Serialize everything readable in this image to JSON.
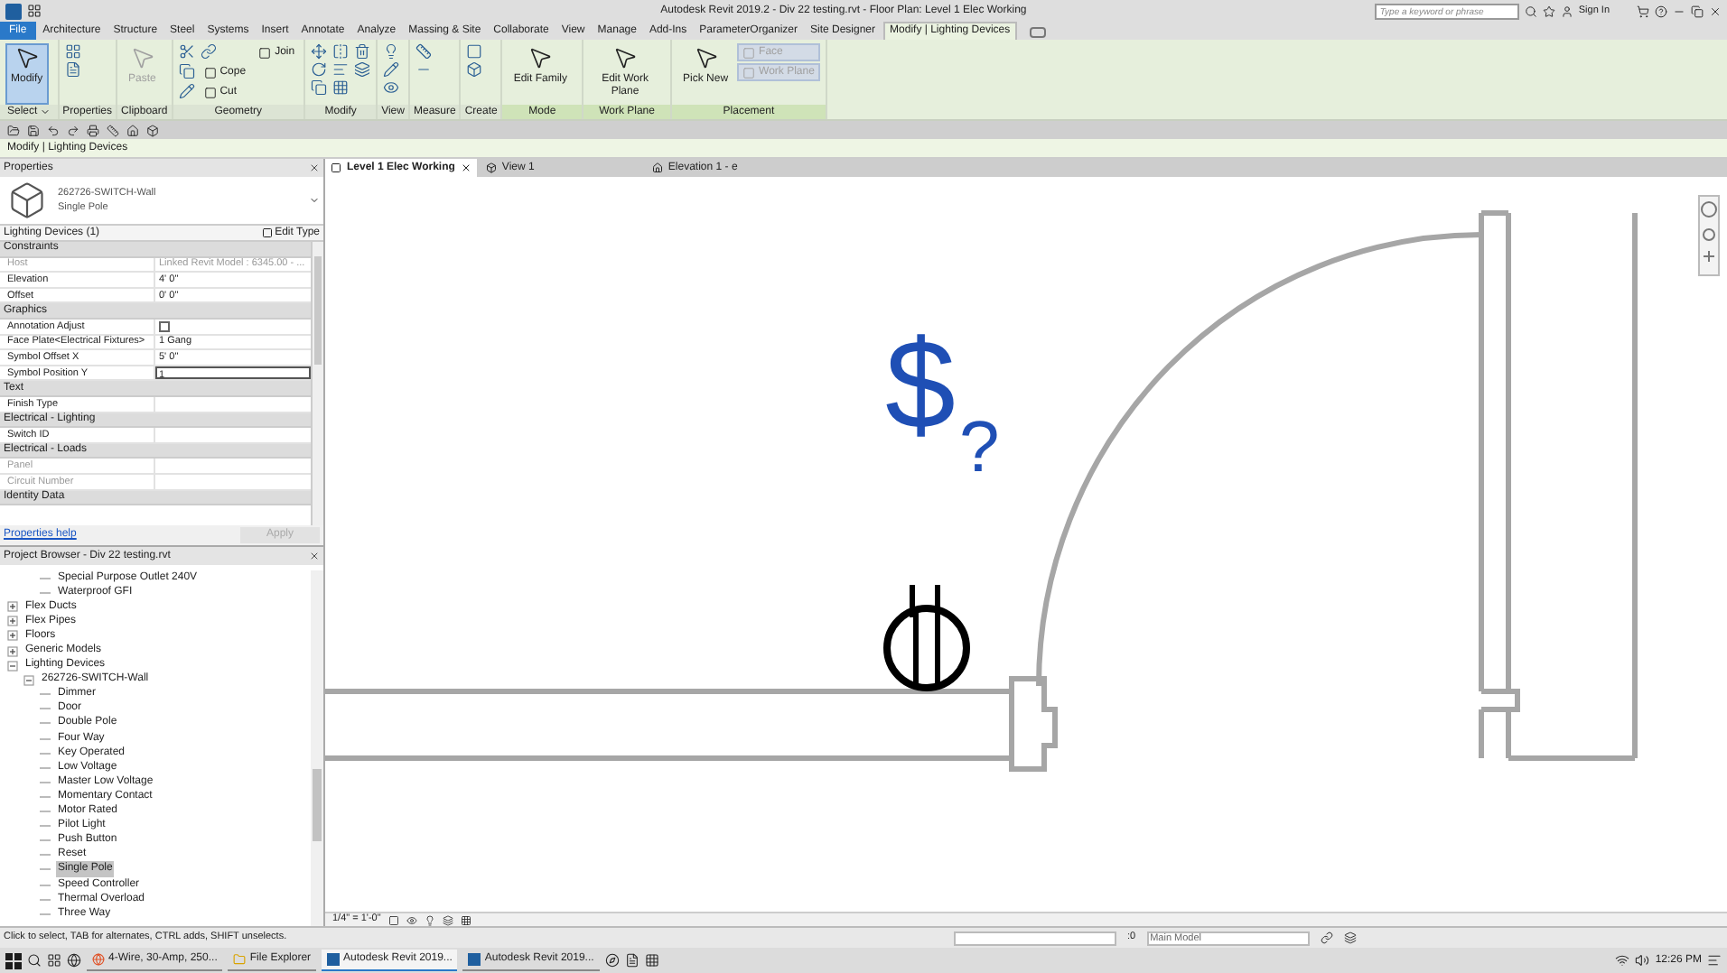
{
  "window": {
    "title": "Autodesk Revit 2019.2 - Div 22 testing.rvt - Floor Plan: Level 1 Elec Working",
    "search_placeholder": "Type a keyword or phrase",
    "sign_in": "Sign In"
  },
  "ribbon_tabs": [
    {
      "label": "File",
      "kind": "file",
      "selected": false
    },
    {
      "label": "Architecture",
      "kind": "tab",
      "selected": false
    },
    {
      "label": "Structure",
      "kind": "tab",
      "selected": false
    },
    {
      "label": "Steel",
      "kind": "tab",
      "selected": false
    },
    {
      "label": "Systems",
      "kind": "tab",
      "selected": false
    },
    {
      "label": "Insert",
      "kind": "tab",
      "selected": false
    },
    {
      "label": "Annotate",
      "kind": "tab",
      "selected": false
    },
    {
      "label": "Analyze",
      "kind": "tab",
      "selected": false
    },
    {
      "label": "Massing & Site",
      "kind": "tab",
      "selected": false
    },
    {
      "label": "Collaborate",
      "kind": "tab",
      "selected": false
    },
    {
      "label": "View",
      "kind": "tab",
      "selected": false
    },
    {
      "label": "Manage",
      "kind": "tab",
      "selected": false
    },
    {
      "label": "Add-Ins",
      "kind": "tab",
      "selected": false
    },
    {
      "label": "ParameterOrganizer",
      "kind": "tab",
      "selected": false
    },
    {
      "label": "Site Designer",
      "kind": "tab",
      "selected": false
    },
    {
      "label": "Modify | Lighting Devices",
      "kind": "tab",
      "selected": true
    }
  ],
  "ribbon_panels": [
    {
      "label": "Select",
      "dropdown": true,
      "contextual": false,
      "tools": [
        {
          "label": "Modify",
          "kind": "large",
          "disabled": false,
          "selected": true
        }
      ]
    },
    {
      "label": "Properties",
      "dropdown": false,
      "contextual": false
    },
    {
      "label": "Clipboard",
      "dropdown": false,
      "contextual": false,
      "tools": [
        {
          "label": "Paste",
          "kind": "large",
          "disabled": true,
          "selected": false
        }
      ]
    },
    {
      "label": "Geometry",
      "dropdown": false,
      "contextual": false,
      "tools": [
        {
          "label": "Cope",
          "kind": "small",
          "disabled": false
        },
        {
          "label": "Cut",
          "kind": "small",
          "disabled": false
        },
        {
          "label": "Join",
          "kind": "small",
          "disabled": false
        }
      ]
    },
    {
      "label": "Modify",
      "dropdown": false,
      "contextual": false
    },
    {
      "label": "View",
      "dropdown": false,
      "contextual": false
    },
    {
      "label": "Measure",
      "dropdown": false,
      "contextual": false
    },
    {
      "label": "Create",
      "dropdown": false,
      "contextual": false
    },
    {
      "label": "Mode",
      "dropdown": false,
      "contextual": true,
      "tools": [
        {
          "label": "Edit Family",
          "kind": "large",
          "disabled": false,
          "selected": false
        }
      ]
    },
    {
      "label": "Work Plane",
      "dropdown": false,
      "contextual": true,
      "tools": [
        {
          "label": "Edit Work Plane",
          "kind": "large",
          "disabled": false,
          "selected": false
        }
      ]
    },
    {
      "label": "Placement",
      "dropdown": false,
      "contextual": true,
      "tools": [
        {
          "label": "Pick New",
          "kind": "large",
          "disabled": false,
          "selected": false
        },
        {
          "label": "Face",
          "kind": "small",
          "disabled": true
        },
        {
          "label": "Work Plane",
          "kind": "small",
          "disabled": true
        }
      ]
    }
  ],
  "context_bar": "Modify | Lighting Devices",
  "properties": {
    "title": "Properties",
    "type_name": "262726-SWITCH-Wall",
    "type_sub": "Single Pole",
    "filter": "Lighting Devices (1)",
    "edit_type": "Edit Type",
    "groups": [
      {
        "name": "Constraints",
        "rows": [
          {
            "label": "Host",
            "value": "Linked Revit Model : 6345.00 - ...",
            "kind": "text",
            "disabled": true
          },
          {
            "label": "Elevation",
            "value": "4'  0\"",
            "kind": "text",
            "disabled": false
          },
          {
            "label": "Offset",
            "value": "0'  0\"",
            "kind": "text",
            "disabled": false
          }
        ]
      },
      {
        "name": "Graphics",
        "rows": [
          {
            "label": "Annotation Adjust",
            "kind": "checkbox",
            "checked": false,
            "disabled": false
          },
          {
            "label": "Face Plate<Electrical Fixtures>",
            "value": "1 Gang",
            "kind": "text",
            "disabled": false
          },
          {
            "label": "Symbol Offset X",
            "value": "5'  0\"",
            "kind": "text",
            "disabled": false
          },
          {
            "label": "Symbol Position Y",
            "value": "1",
            "kind": "input",
            "disabled": false
          }
        ]
      },
      {
        "name": "Text",
        "rows": [
          {
            "label": "Finish Type",
            "value": "",
            "kind": "text",
            "disabled": false
          }
        ]
      },
      {
        "name": "Electrical - Lighting",
        "rows": [
          {
            "label": "Switch ID",
            "kind": "text",
            "disabled": false
          }
        ]
      },
      {
        "name": "Electrical - Loads",
        "rows": [
          {
            "label": "Panel",
            "kind": "text",
            "disabled": true
          },
          {
            "label": "Circuit Number",
            "kind": "text",
            "disabled": true
          }
        ]
      },
      {
        "name": "Identity Data"
      }
    ],
    "help": "Properties help",
    "apply": "Apply"
  },
  "project_browser": {
    "title": "Project Browser - Div 22 testing.rvt",
    "tree": [
      {
        "children": [
          {
            "children": [
              {
                "label": "Special Purpose Outlet 240V",
                "selected": false
              },
              {
                "label": "Waterproof GFI",
                "selected": false
              }
            ]
          }
        ]
      },
      {
        "label": "Flex Ducts",
        "expanded": false,
        "selected": false
      },
      {
        "label": "Flex Pipes",
        "expanded": false,
        "selected": false
      },
      {
        "label": "Floors",
        "expanded": false,
        "selected": false
      },
      {
        "label": "Generic Models",
        "expanded": false,
        "selected": false
      },
      {
        "label": "Lighting Devices",
        "expanded": true,
        "selected": false,
        "children": [
          {
            "label": "262726-SWITCH-Wall",
            "expanded": true,
            "selected": false,
            "children": [
              {
                "label": "Dimmer",
                "selected": false
              },
              {
                "label": "Door",
                "selected": false
              },
              {
                "label": "Double Pole",
                "selected": false
              },
              {
                "label": "Four Way",
                "selected": false
              },
              {
                "label": "Key Operated",
                "selected": false
              },
              {
                "label": "Low Voltage",
                "selected": false
              },
              {
                "label": "Master Low Voltage",
                "selected": false
              },
              {
                "label": "Momentary Contact",
                "selected": false
              },
              {
                "label": "Motor Rated",
                "selected": false
              },
              {
                "label": "Pilot Light",
                "selected": false
              },
              {
                "label": "Push Button",
                "selected": false
              },
              {
                "label": "Reset",
                "selected": false
              },
              {
                "label": "Single Pole",
                "selected": true
              },
              {
                "label": "Speed Controller",
                "selected": false
              },
              {
                "label": "Thermal Overload",
                "selected": false
              },
              {
                "label": "Three Way",
                "selected": false
              }
            ]
          }
        ]
      }
    ]
  },
  "view_tabs": [
    {
      "label": "Level 1 Elec Working",
      "kind": "plan",
      "selected": true
    },
    {
      "label": "View 1",
      "kind": "perspective",
      "selected": false
    },
    {
      "label": "Elevation 1 - e",
      "kind": "elevation",
      "selected": false
    }
  ],
  "canvas": {
    "switch_symbol": "$",
    "question_mark": "?"
  },
  "view_control_bar": {
    "scale": "1/4\" = 1'-0\""
  },
  "status_bar": {
    "message": "Click to select, TAB for alternates, CTRL adds, SHIFT unselects.",
    "count": ":0",
    "model": "Main Model"
  },
  "taskbar": {
    "apps": [
      {
        "label": "4-Wire, 30-Amp, 250...",
        "kind": "browser",
        "selected": false
      },
      {
        "label": "File Explorer",
        "kind": "folder",
        "selected": false
      },
      {
        "label": "Autodesk Revit 2019...",
        "kind": "revit",
        "selected": true
      },
      {
        "label": "Autodesk Revit 2019...",
        "kind": "revit",
        "selected": false
      }
    ],
    "time": "12:26 PM"
  }
}
